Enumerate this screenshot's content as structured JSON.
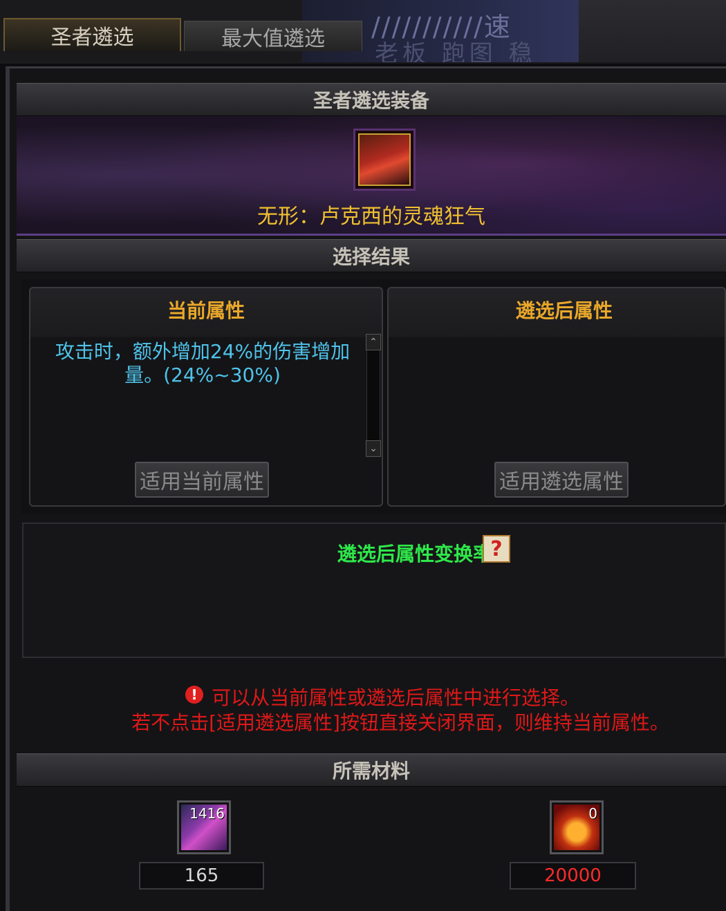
{
  "tabs": [
    {
      "label": "圣者遴选",
      "active": true
    },
    {
      "label": "最大值遴选",
      "active": false
    }
  ],
  "background_strip": {
    "line1": "///////////速",
    "line2": "老板 跑图 稳"
  },
  "equipment": {
    "header": "圣者遴选装备",
    "name": "无形：卢克西的灵魂狂气"
  },
  "result": {
    "header": "选择结果",
    "current": {
      "title": "当前属性",
      "line1": "攻击时，额外增加24%的伤害增加",
      "line2": "量。(24%~30%)",
      "button": "适用当前属性"
    },
    "after": {
      "title": "遴选后属性",
      "button": "适用遴选属性"
    }
  },
  "conversion": {
    "title": "遴选后属性变换率",
    "help_glyph": "?"
  },
  "warning": {
    "line1": "可以从当前属性或遴选后属性中进行选择。",
    "line2": "若不点击[适用遴选属性]按钮直接关闭界面，则维持当前属性。"
  },
  "materials": {
    "header": "所需材料",
    "items": [
      {
        "icon": "crystal-icon",
        "count": "1416",
        "required": "165",
        "color": "#d8d8d8"
      },
      {
        "icon": "gold-icon",
        "count": "0",
        "required": "20000",
        "color": "#ff2a2a"
      }
    ]
  }
}
